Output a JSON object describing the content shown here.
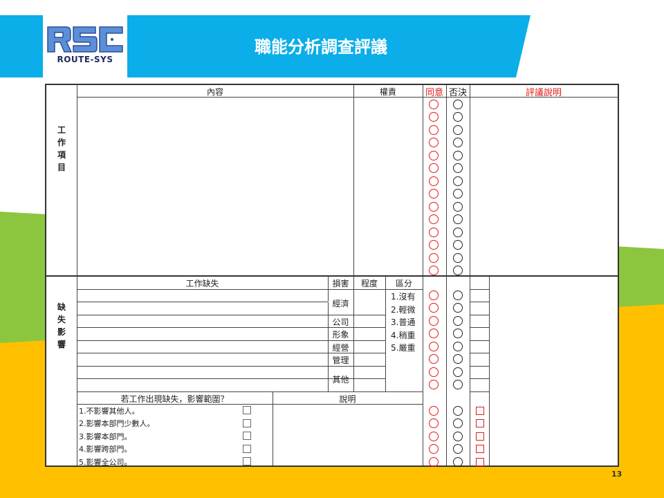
{
  "header": {
    "title": "職能分析調查評議",
    "logo_letters": "RSC",
    "logo_text": "ROUTE-SYS",
    "page_number": "13"
  },
  "colors": {
    "banner": "#0baee8",
    "green": "#8cc63f",
    "yellow": "#ffc000",
    "accent_red": "#e01818"
  },
  "form": {
    "section1_label": "工作項目",
    "headers": {
      "content": "內容",
      "authority": "權責",
      "agree": "同意",
      "veto": "否決",
      "comment": "評議說明"
    },
    "section2_label": "缺失影響",
    "section2_headers": {
      "defect": "工作缺失",
      "damage": "損害",
      "degree": "程度",
      "division": "區分"
    },
    "damage_types": [
      "經濟",
      "公司形象",
      "經營管理",
      "其他"
    ],
    "divisions": [
      "1.沒有",
      "2.輕微",
      "3.普通",
      "4.稍重",
      "5.嚴重"
    ],
    "impact_question": "若工作出現缺失，影響範圍？",
    "explain_header": "說明",
    "impact_options": [
      "1.不影響其他人。",
      "2.影響本部門少數人。",
      "3.影響本部門。",
      "4.影響跨部門。",
      "5.影響全公司。"
    ]
  }
}
